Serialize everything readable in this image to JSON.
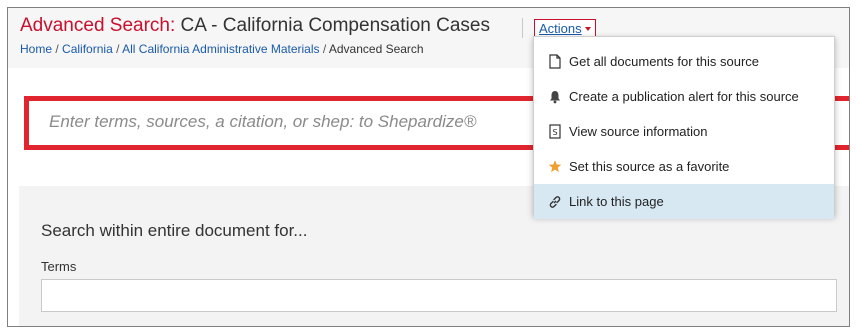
{
  "header": {
    "title_prefix": "Advanced Search:",
    "title_name": "CA - California Compensation Cases",
    "actions_label": "Actions"
  },
  "breadcrumb": {
    "items": [
      "Home",
      "California",
      "All California Administrative Materials",
      "Advanced Search"
    ],
    "separator": "/"
  },
  "search": {
    "placeholder": "Enter terms, sources, a citation, or shep: to Shepardize®"
  },
  "panel": {
    "title": "Search within entire document for...",
    "terms_label": "Terms",
    "terms_value": ""
  },
  "actions_menu": {
    "items": [
      {
        "label": "Get all documents for this source",
        "icon": "document-icon"
      },
      {
        "label": "Create a publication alert for this source",
        "icon": "bell-icon"
      },
      {
        "label": "View source information",
        "icon": "source-info-icon"
      },
      {
        "label": "Set this source as a favorite",
        "icon": "star-icon"
      },
      {
        "label": "Link to this page",
        "icon": "link-icon",
        "active": true
      }
    ]
  },
  "colors": {
    "brand_red": "#e1252e",
    "title_red": "#c8102e",
    "link_blue": "#1a5aaa",
    "favorite_orange": "#f0a030",
    "active_item_bg": "#d7e8f3"
  }
}
